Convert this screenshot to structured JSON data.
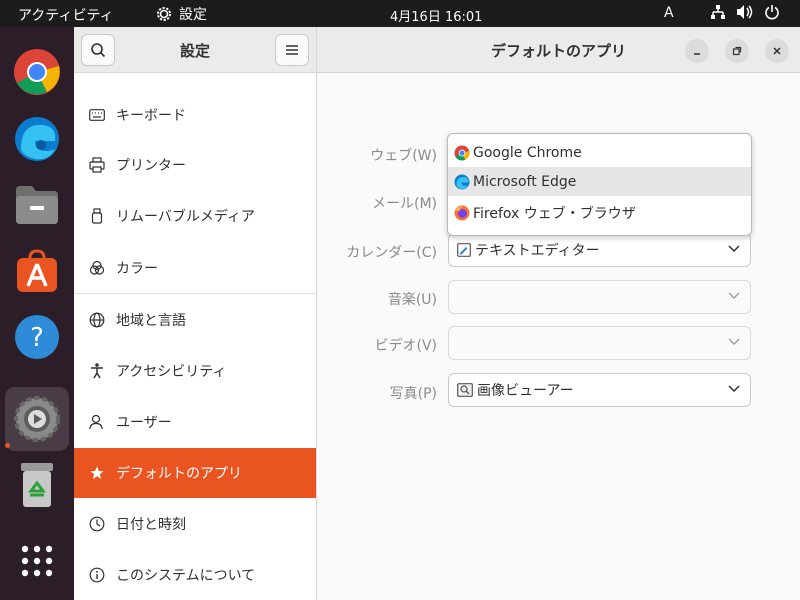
{
  "topbar": {
    "activities": "アクティビティ",
    "app_name": "設定",
    "clock": "4月16日  16:01",
    "ime": "A"
  },
  "dock": {
    "items": [
      "chrome-icon",
      "edge-icon",
      "files-icon",
      "app-center-icon",
      "help-icon",
      "settings-icon",
      "trash-icon",
      "app-grid-icon"
    ]
  },
  "window": {
    "sidebar_title": "設定",
    "content_title": "デフォルトのアプリ"
  },
  "sidebar": {
    "items": [
      {
        "label": "キーボード"
      },
      {
        "label": "プリンター"
      },
      {
        "label": "リムーバブルメディア"
      },
      {
        "label": "カラー"
      },
      {
        "label": "地域と言語"
      },
      {
        "label": "アクセシビリティ"
      },
      {
        "label": "ユーザー"
      },
      {
        "label": "デフォルトのアプリ"
      },
      {
        "label": "日付と時刻"
      },
      {
        "label": "このシステムについて"
      }
    ]
  },
  "defaults": {
    "web_label": "ウェブ(W)",
    "mail_label": "メール(M)",
    "calendar_label": "カレンダー(C)",
    "calendar_value": "テキストエディター",
    "music_label": "音楽(U)",
    "video_label": "ビデオ(V)",
    "photos_label": "写真(P)",
    "photos_value": "画像ビューアー"
  },
  "web_popup": {
    "options": [
      "Google Chrome",
      "Microsoft Edge",
      "Firefox ウェブ・ブラウザ"
    ],
    "highlighted": "Microsoft Edge"
  },
  "colors": {
    "accent": "#e95420",
    "dock_bg": "#2c1e28",
    "topbar_bg": "#1c1c1c"
  }
}
